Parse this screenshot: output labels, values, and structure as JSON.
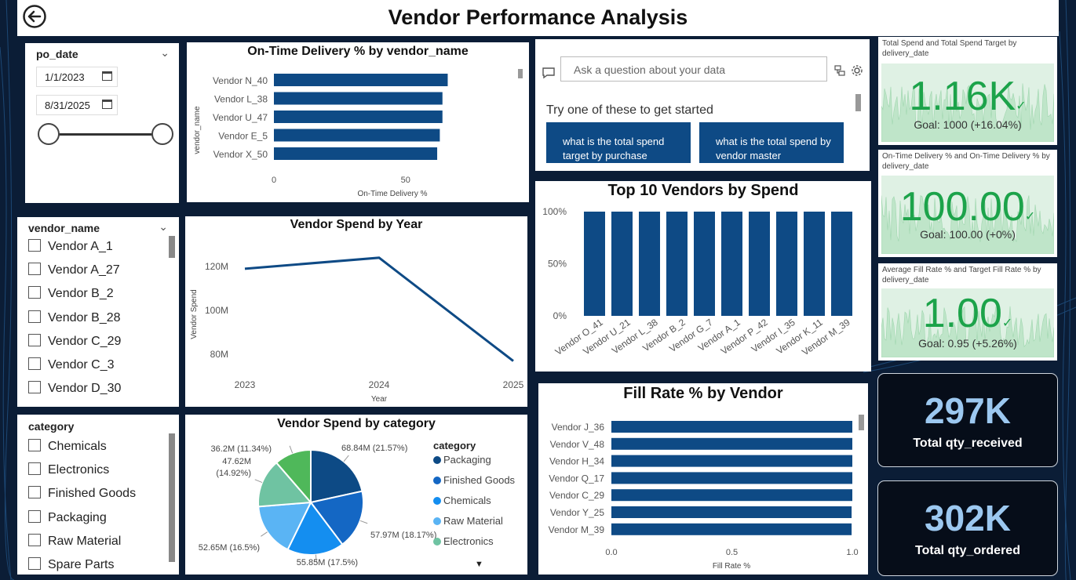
{
  "header": {
    "title": "Vendor Performance Analysis",
    "back_icon": "back-arrow-icon"
  },
  "date_slicer": {
    "label": "po_date",
    "start": "1/1/2023",
    "end": "8/31/2025"
  },
  "vendor_slicer": {
    "label": "vendor_name",
    "items": [
      "Vendor A_1",
      "Vendor A_27",
      "Vendor B_2",
      "Vendor B_28",
      "Vendor C_29",
      "Vendor C_3",
      "Vendor D_30"
    ]
  },
  "category_slicer": {
    "label": "category",
    "items": [
      "Chemicals",
      "Electronics",
      "Finished Goods",
      "Packaging",
      "Raw Material",
      "Spare Parts"
    ]
  },
  "qa": {
    "placeholder": "Ask a question about your data",
    "prompt": "Try one of these to get started",
    "suggestions": [
      "what is the total spend target by purchase",
      "what is the total spend by vendor master"
    ]
  },
  "kpis": [
    {
      "label": "Total Spend and Total Spend Target by delivery_date",
      "value": "1.16K",
      "goal": "Goal: 1000 (+16.04%)"
    },
    {
      "label": "On-Time Delivery % and On-Time Delivery % by delivery_date",
      "value": "100.00",
      "goal": "Goal: 100.00 (+0%)"
    },
    {
      "label": "Average Fill Rate % and Target Fill Rate % by delivery_date",
      "value": "1.00",
      "goal": "Goal: 0.95 (+5.26%)"
    }
  ],
  "cards": [
    {
      "value": "297K",
      "label": "Total qty_received"
    },
    {
      "value": "302K",
      "label": "Total qty_ordered"
    }
  ],
  "colors": {
    "bar": "#0e4a85",
    "kpi_green": "#1ca34a",
    "card_value": "#9cc8f0"
  },
  "chart_data": [
    {
      "id": "ontime",
      "type": "bar",
      "orientation": "horizontal",
      "title": "On-Time Delivery % by vendor_name",
      "xlabel": "On-Time Delivery %",
      "ylabel": "vendor_name",
      "categories": [
        "Vendor N_40",
        "Vendor L_38",
        "Vendor U_47",
        "Vendor E_5",
        "Vendor X_50"
      ],
      "values": [
        66,
        64,
        64,
        63,
        62
      ],
      "xlim": [
        0,
        90
      ],
      "xticks": [
        "0",
        "50"
      ]
    },
    {
      "id": "spendyear",
      "type": "line",
      "title": "Vendor Spend by Year",
      "xlabel": "Year",
      "ylabel": "Vendor Spend",
      "x": [
        "2023",
        "2024",
        "2025"
      ],
      "values": [
        119,
        124,
        77
      ],
      "ylim": [
        74,
        130
      ],
      "yticks": [
        80,
        100,
        120
      ],
      "ytick_labels": [
        "80M",
        "100M",
        "120M"
      ]
    },
    {
      "id": "pie",
      "type": "pie",
      "title": "Vendor Spend by category",
      "legend_title": "category",
      "slices": [
        {
          "name": "Packaging",
          "value": 68.84,
          "label": "68.84M (21.57%)",
          "color": "#0d4a85"
        },
        {
          "name": "Finished Goods",
          "value": 57.97,
          "label": "57.97M (18.17%)",
          "color": "#1467c4"
        },
        {
          "name": "Chemicals",
          "value": 55.85,
          "label": "55.85M (17.5%)",
          "color": "#148ef0"
        },
        {
          "name": "Raw Material",
          "value": 52.65,
          "label": "52.65M (16.5%)",
          "color": "#5ab4f4"
        },
        {
          "name": "Electronics",
          "value": 47.62,
          "label": "47.62M (14.92%)",
          "color": "#6fc3a2"
        },
        {
          "name": "Spare Parts",
          "value": 36.2,
          "label": "36.2M (11.34%)",
          "color": "#4fb85a"
        }
      ]
    },
    {
      "id": "top10",
      "type": "bar",
      "title": "Top 10 Vendors by Spend",
      "categories": [
        "Vendor O_41",
        "Vendor U_21",
        "Vendor L_38",
        "Vendor B_2",
        "Vendor G_7",
        "Vendor A_1",
        "Vendor P_42",
        "Vendor I_35",
        "Vendor K_11",
        "Vendor M_39"
      ],
      "values": [
        100,
        100,
        100,
        100,
        100,
        100,
        100,
        100,
        100,
        100
      ],
      "ylim": [
        0,
        100
      ],
      "yticks": [
        "0%",
        "50%",
        "100%"
      ]
    },
    {
      "id": "fillrate",
      "type": "bar",
      "orientation": "horizontal",
      "title": "Fill Rate % by Vendor",
      "xlabel": "Fill Rate %",
      "categories": [
        "Vendor J_36",
        "Vendor V_48",
        "Vendor H_34",
        "Vendor Q_17",
        "Vendor C_29",
        "Vendor Y_25",
        "Vendor M_39"
      ],
      "values": [
        1.0,
        1.0,
        1.0,
        1.0,
        1.0,
        0.997,
        0.997
      ],
      "xlim": [
        0,
        1
      ],
      "xticks": [
        "0.0",
        "0.5",
        "1.0"
      ]
    }
  ]
}
